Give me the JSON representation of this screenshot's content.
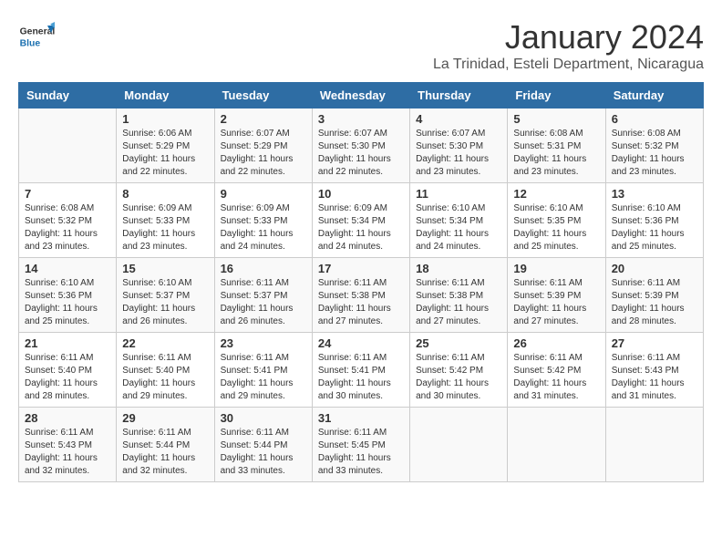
{
  "logo": {
    "general": "General",
    "blue": "Blue"
  },
  "title": "January 2024",
  "location": "La Trinidad, Esteli Department, Nicaragua",
  "weekdays": [
    "Sunday",
    "Monday",
    "Tuesday",
    "Wednesday",
    "Thursday",
    "Friday",
    "Saturday"
  ],
  "weeks": [
    [
      {
        "day": "",
        "info": ""
      },
      {
        "day": "1",
        "info": "Sunrise: 6:06 AM\nSunset: 5:29 PM\nDaylight: 11 hours\nand 22 minutes."
      },
      {
        "day": "2",
        "info": "Sunrise: 6:07 AM\nSunset: 5:29 PM\nDaylight: 11 hours\nand 22 minutes."
      },
      {
        "day": "3",
        "info": "Sunrise: 6:07 AM\nSunset: 5:30 PM\nDaylight: 11 hours\nand 22 minutes."
      },
      {
        "day": "4",
        "info": "Sunrise: 6:07 AM\nSunset: 5:30 PM\nDaylight: 11 hours\nand 23 minutes."
      },
      {
        "day": "5",
        "info": "Sunrise: 6:08 AM\nSunset: 5:31 PM\nDaylight: 11 hours\nand 23 minutes."
      },
      {
        "day": "6",
        "info": "Sunrise: 6:08 AM\nSunset: 5:32 PM\nDaylight: 11 hours\nand 23 minutes."
      }
    ],
    [
      {
        "day": "7",
        "info": "Sunrise: 6:08 AM\nSunset: 5:32 PM\nDaylight: 11 hours\nand 23 minutes."
      },
      {
        "day": "8",
        "info": "Sunrise: 6:09 AM\nSunset: 5:33 PM\nDaylight: 11 hours\nand 23 minutes."
      },
      {
        "day": "9",
        "info": "Sunrise: 6:09 AM\nSunset: 5:33 PM\nDaylight: 11 hours\nand 24 minutes."
      },
      {
        "day": "10",
        "info": "Sunrise: 6:09 AM\nSunset: 5:34 PM\nDaylight: 11 hours\nand 24 minutes."
      },
      {
        "day": "11",
        "info": "Sunrise: 6:10 AM\nSunset: 5:34 PM\nDaylight: 11 hours\nand 24 minutes."
      },
      {
        "day": "12",
        "info": "Sunrise: 6:10 AM\nSunset: 5:35 PM\nDaylight: 11 hours\nand 25 minutes."
      },
      {
        "day": "13",
        "info": "Sunrise: 6:10 AM\nSunset: 5:36 PM\nDaylight: 11 hours\nand 25 minutes."
      }
    ],
    [
      {
        "day": "14",
        "info": "Sunrise: 6:10 AM\nSunset: 5:36 PM\nDaylight: 11 hours\nand 25 minutes."
      },
      {
        "day": "15",
        "info": "Sunrise: 6:10 AM\nSunset: 5:37 PM\nDaylight: 11 hours\nand 26 minutes."
      },
      {
        "day": "16",
        "info": "Sunrise: 6:11 AM\nSunset: 5:37 PM\nDaylight: 11 hours\nand 26 minutes."
      },
      {
        "day": "17",
        "info": "Sunrise: 6:11 AM\nSunset: 5:38 PM\nDaylight: 11 hours\nand 27 minutes."
      },
      {
        "day": "18",
        "info": "Sunrise: 6:11 AM\nSunset: 5:38 PM\nDaylight: 11 hours\nand 27 minutes."
      },
      {
        "day": "19",
        "info": "Sunrise: 6:11 AM\nSunset: 5:39 PM\nDaylight: 11 hours\nand 27 minutes."
      },
      {
        "day": "20",
        "info": "Sunrise: 6:11 AM\nSunset: 5:39 PM\nDaylight: 11 hours\nand 28 minutes."
      }
    ],
    [
      {
        "day": "21",
        "info": "Sunrise: 6:11 AM\nSunset: 5:40 PM\nDaylight: 11 hours\nand 28 minutes."
      },
      {
        "day": "22",
        "info": "Sunrise: 6:11 AM\nSunset: 5:40 PM\nDaylight: 11 hours\nand 29 minutes."
      },
      {
        "day": "23",
        "info": "Sunrise: 6:11 AM\nSunset: 5:41 PM\nDaylight: 11 hours\nand 29 minutes."
      },
      {
        "day": "24",
        "info": "Sunrise: 6:11 AM\nSunset: 5:41 PM\nDaylight: 11 hours\nand 30 minutes."
      },
      {
        "day": "25",
        "info": "Sunrise: 6:11 AM\nSunset: 5:42 PM\nDaylight: 11 hours\nand 30 minutes."
      },
      {
        "day": "26",
        "info": "Sunrise: 6:11 AM\nSunset: 5:42 PM\nDaylight: 11 hours\nand 31 minutes."
      },
      {
        "day": "27",
        "info": "Sunrise: 6:11 AM\nSunset: 5:43 PM\nDaylight: 11 hours\nand 31 minutes."
      }
    ],
    [
      {
        "day": "28",
        "info": "Sunrise: 6:11 AM\nSunset: 5:43 PM\nDaylight: 11 hours\nand 32 minutes."
      },
      {
        "day": "29",
        "info": "Sunrise: 6:11 AM\nSunset: 5:44 PM\nDaylight: 11 hours\nand 32 minutes."
      },
      {
        "day": "30",
        "info": "Sunrise: 6:11 AM\nSunset: 5:44 PM\nDaylight: 11 hours\nand 33 minutes."
      },
      {
        "day": "31",
        "info": "Sunrise: 6:11 AM\nSunset: 5:45 PM\nDaylight: 11 hours\nand 33 minutes."
      },
      {
        "day": "",
        "info": ""
      },
      {
        "day": "",
        "info": ""
      },
      {
        "day": "",
        "info": ""
      }
    ]
  ]
}
